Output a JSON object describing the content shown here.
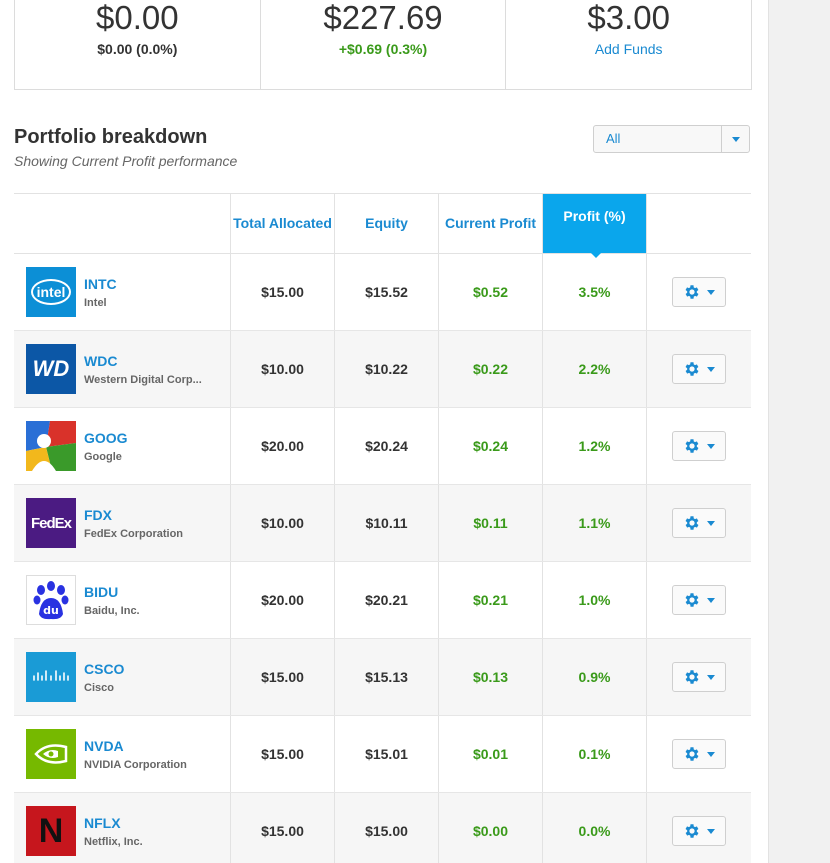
{
  "summary": [
    {
      "value": "$0.00",
      "sub": "$0.00 (0.0%)"
    },
    {
      "value": "$227.69",
      "sub": "+$0.69 (0.3%)"
    },
    {
      "value": "$3.00",
      "sub": "Add Funds"
    }
  ],
  "section": {
    "title": "Portfolio breakdown",
    "subtitle": "Showing Current Profit performance",
    "filter": "All"
  },
  "table": {
    "headers": [
      "",
      "Total Allocated",
      "Equity",
      "Current Profit",
      "Profit (%)",
      ""
    ],
    "rows": [
      {
        "symbol": "INTC",
        "name": "Intel",
        "allocated": "$15.00",
        "equity": "$15.52",
        "profit": "$0.52",
        "percent": "3.5%"
      },
      {
        "symbol": "WDC",
        "name": "Western Digital Corp...",
        "allocated": "$10.00",
        "equity": "$10.22",
        "profit": "$0.22",
        "percent": "2.2%"
      },
      {
        "symbol": "GOOG",
        "name": "Google",
        "allocated": "$20.00",
        "equity": "$20.24",
        "profit": "$0.24",
        "percent": "1.2%"
      },
      {
        "symbol": "FDX",
        "name": "FedEx Corporation",
        "allocated": "$10.00",
        "equity": "$10.11",
        "profit": "$0.11",
        "percent": "1.1%"
      },
      {
        "symbol": "BIDU",
        "name": "Baidu, Inc.",
        "allocated": "$20.00",
        "equity": "$20.21",
        "profit": "$0.21",
        "percent": "1.0%"
      },
      {
        "symbol": "CSCO",
        "name": "Cisco",
        "allocated": "$15.00",
        "equity": "$15.13",
        "profit": "$0.13",
        "percent": "0.9%"
      },
      {
        "symbol": "NVDA",
        "name": "NVIDIA Corporation",
        "allocated": "$15.00",
        "equity": "$15.01",
        "profit": "$0.01",
        "percent": "0.1%"
      },
      {
        "symbol": "NFLX",
        "name": "Netflix, Inc.",
        "allocated": "$15.00",
        "equity": "$15.00",
        "profit": "$0.00",
        "percent": "0.0%"
      }
    ]
  },
  "logos": {
    "intel": "intel",
    "wdc": "WD",
    "fdx": "FedEx",
    "bidu": "du",
    "nflx": "N"
  },
  "colors": {
    "accent": "#1a8ad1",
    "active_header": "#0aa6ec",
    "positive": "#3a9a1a"
  }
}
